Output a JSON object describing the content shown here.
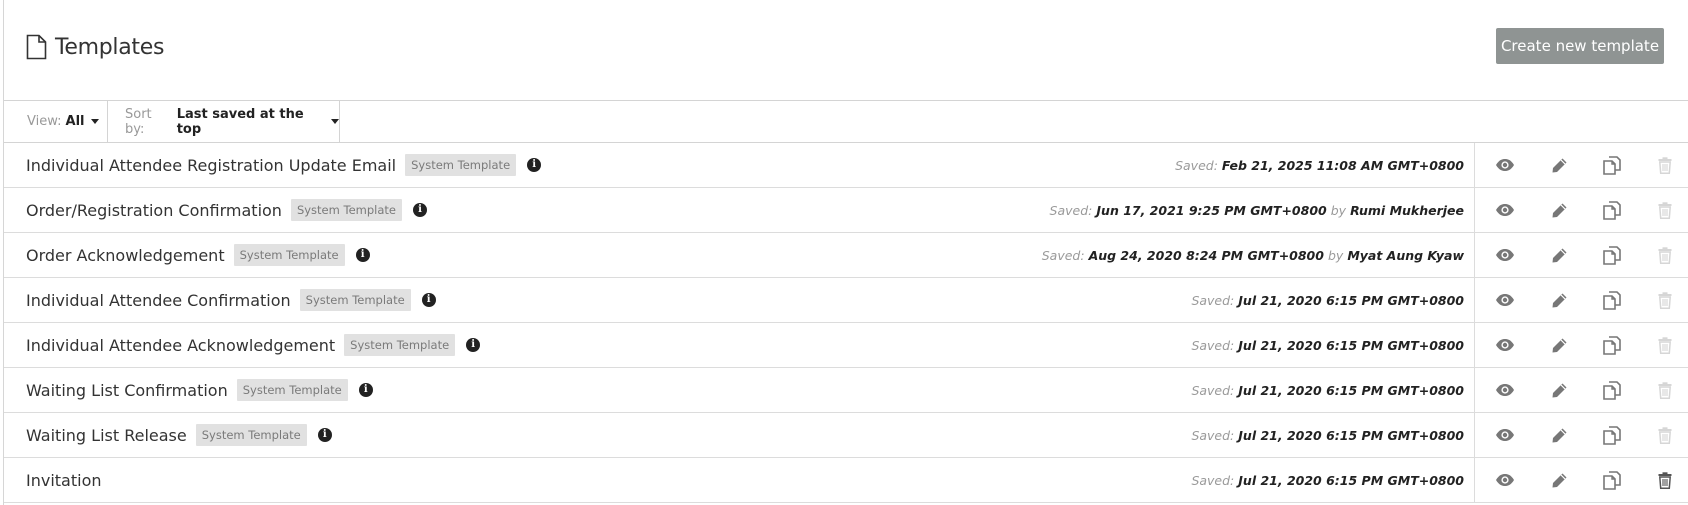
{
  "header": {
    "title": "Templates",
    "create_button": "Create new template"
  },
  "toolbar": {
    "view_label": "View:",
    "view_value": "All",
    "sort_label": "Sort by:",
    "sort_value": "Last saved at the top"
  },
  "saved_label": "Saved:",
  "by_label": "by",
  "badge_label": "System Template",
  "colors": {
    "button": "#8f9493",
    "badge_bg": "#e1e1e1",
    "icon": "#777777",
    "icon_disabled": "#d6d6d6"
  },
  "rows": [
    {
      "name": "Individual Attendee Registration Update Email",
      "system": true,
      "date": "Feb 21, 2025 11:08 AM GMT+0800",
      "author": "",
      "deletable": false
    },
    {
      "name": "Order/Registration Confirmation",
      "system": true,
      "date": "Jun 17, 2021 9:25 PM GMT+0800",
      "author": "Rumi Mukherjee",
      "deletable": false
    },
    {
      "name": "Order Acknowledgement",
      "system": true,
      "date": "Aug 24, 2020 8:24 PM GMT+0800",
      "author": "Myat Aung Kyaw",
      "deletable": false
    },
    {
      "name": "Individual Attendee Confirmation",
      "system": true,
      "date": "Jul 21, 2020 6:15 PM GMT+0800",
      "author": "",
      "deletable": false
    },
    {
      "name": "Individual Attendee Acknowledgement",
      "system": true,
      "date": "Jul 21, 2020 6:15 PM GMT+0800",
      "author": "",
      "deletable": false
    },
    {
      "name": "Waiting List Confirmation",
      "system": true,
      "date": "Jul 21, 2020 6:15 PM GMT+0800",
      "author": "",
      "deletable": false
    },
    {
      "name": "Waiting List Release",
      "system": true,
      "date": "Jul 21, 2020 6:15 PM GMT+0800",
      "author": "",
      "deletable": false
    },
    {
      "name": "Invitation",
      "system": false,
      "date": "Jul 21, 2020 6:15 PM GMT+0800",
      "author": "",
      "deletable": true
    }
  ]
}
